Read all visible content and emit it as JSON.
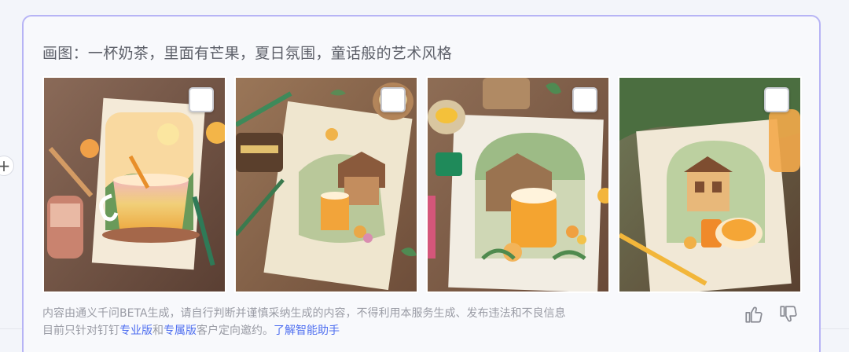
{
  "prompt": "画图：一杯奶茶，里面有芒果，夏日氛围，童话般的艺术风格",
  "images": [
    {
      "alt": "芒果奶茶插画 1",
      "selected": false
    },
    {
      "alt": "芒果奶茶插画 2",
      "selected": false
    },
    {
      "alt": "芒果奶茶插画 3",
      "selected": false
    },
    {
      "alt": "芒果奶茶插画 4",
      "selected": false
    }
  ],
  "disclaimer": {
    "line1": "内容由通义千问BETA生成，请自行判断并谨慎采纳生成的内容，不得利用本服务生成、发布违法和不良信息",
    "line2_prefix": "目前只针对钉钉",
    "link_pro": "专业版",
    "and": "和",
    "link_exclusive": "专属版",
    "line2_suffix": "客户定向邀约。",
    "link_learn": "了解智能助手"
  },
  "colors": {
    "accent": "#4f6ff0",
    "card_border": "#b7b4f5"
  },
  "icons": {
    "like": "thumbs-up-icon",
    "dislike": "thumbs-down-icon",
    "add": "plus-icon"
  }
}
